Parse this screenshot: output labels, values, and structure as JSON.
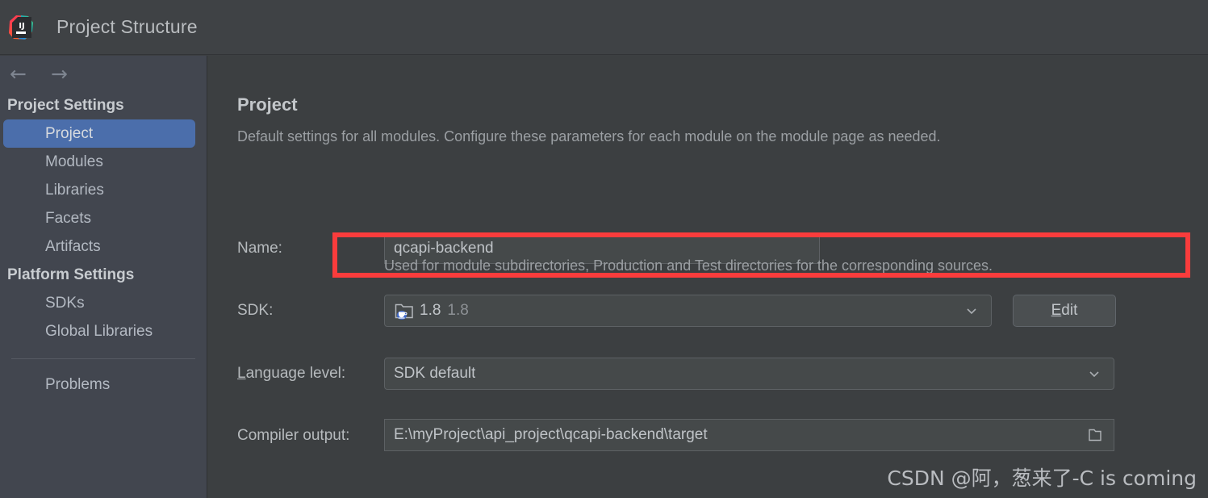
{
  "window": {
    "title": "Project Structure",
    "logo_icon": "intellij-idea-logo",
    "logo_text": "IJ"
  },
  "sidebar": {
    "back_icon": "arrow-left-icon",
    "forward_icon": "arrow-right-icon",
    "groups": [
      {
        "title": "Project Settings",
        "items": [
          {
            "label": "Project",
            "selected": true
          },
          {
            "label": "Modules",
            "selected": false
          },
          {
            "label": "Libraries",
            "selected": false
          },
          {
            "label": "Facets",
            "selected": false
          },
          {
            "label": "Artifacts",
            "selected": false
          }
        ]
      },
      {
        "title": "Platform Settings",
        "items": [
          {
            "label": "SDKs",
            "selected": false
          },
          {
            "label": "Global Libraries",
            "selected": false
          }
        ]
      }
    ],
    "footer_items": [
      {
        "label": "Problems",
        "selected": false
      }
    ]
  },
  "main": {
    "heading": "Project",
    "description": "Default settings for all modules. Configure these parameters for each module on the module page as needed.",
    "fields": {
      "name": {
        "label": "Name:",
        "value": "qcapi-backend"
      },
      "sdk": {
        "label": "SDK:",
        "icon": "jdk-folder-icon",
        "value": "1.8",
        "value_secondary": "1.8",
        "chevron_icon": "chevron-down-icon",
        "edit_button": {
          "label": "Edit",
          "mnemonic": "E",
          "rest": "dit"
        }
      },
      "language_level": {
        "label_mnemonic": "L",
        "label_rest": "anguage level:",
        "value": "SDK default",
        "chevron_icon": "chevron-down-icon"
      },
      "compiler_output": {
        "label": "Compiler output:",
        "value": "E:\\myProject\\api_project\\qcapi-backend\\target",
        "browse_icon": "folder-browse-icon",
        "hint": "Used for module subdirectories, Production and Test directories for the corresponding sources."
      }
    }
  },
  "annotation": {
    "highlight_color": "#fa3c3c",
    "target": "sdk-row"
  },
  "watermark": {
    "text": "CSDN @阿，葱来了-C is coming"
  },
  "colors": {
    "accent_selected": "#4b6eab",
    "sidebar_bg": "#42464f",
    "content_bg": "#3c3f41",
    "titlebar_bg": "#3f4245",
    "annotation_red": "#fa3c3c"
  }
}
